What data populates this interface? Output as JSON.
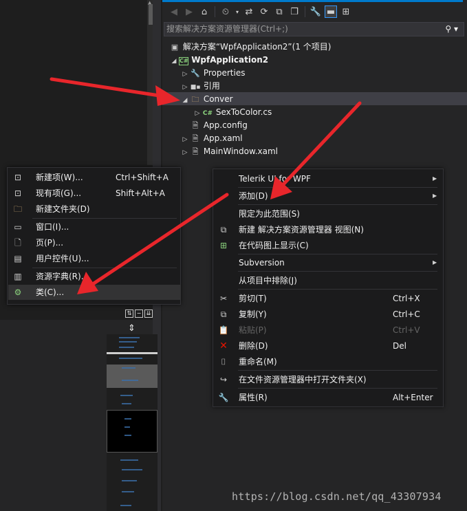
{
  "solution_explorer": {
    "search_placeholder": "搜索解决方案资源管理器(Ctrl+;)",
    "tree": [
      {
        "label": "解决方案“WpfApplication2”(1 个项目)",
        "icon": "solution-icon",
        "level": 0,
        "arrow": ""
      },
      {
        "label": "WpfApplication2",
        "icon": "csharp-project-icon",
        "level": 1,
        "arrow": "expanded",
        "bold": true
      },
      {
        "label": "Properties",
        "icon": "wrench-icon",
        "level": 2,
        "arrow": "collapsed"
      },
      {
        "label": "引用",
        "icon": "references-icon",
        "level": 2,
        "arrow": "collapsed"
      },
      {
        "label": "Conver",
        "icon": "folder-icon",
        "level": 2,
        "arrow": "expanded",
        "selected": true
      },
      {
        "label": "SexToColor.cs",
        "icon": "csharp-file-icon",
        "level": 3,
        "arrow": "collapsed"
      },
      {
        "label": "App.config",
        "icon": "config-icon",
        "level": 2,
        "arrow": ""
      },
      {
        "label": "App.xaml",
        "icon": "xaml-icon",
        "level": 2,
        "arrow": "collapsed"
      },
      {
        "label": "MainWindow.xaml",
        "icon": "xaml-icon",
        "level": 2,
        "arrow": "collapsed"
      }
    ]
  },
  "context_menu": {
    "items": [
      {
        "label": "Telerik UI for WPF",
        "submenu": true
      },
      {
        "label": "添加(D)",
        "submenu": true
      },
      {
        "label": "限定为此范围(S)"
      },
      {
        "label": "新建 解决方案资源管理器 视图(N)",
        "icon": "new-view-icon"
      },
      {
        "label": "在代码图上显示(C)",
        "icon": "code-map-icon"
      },
      {
        "label": "Subversion",
        "submenu": true
      },
      {
        "label": "从项目中排除(J)"
      },
      {
        "label": "剪切(T)",
        "shortcut": "Ctrl+X",
        "icon": "cut-icon"
      },
      {
        "label": "复制(Y)",
        "shortcut": "Ctrl+C",
        "icon": "copy-icon"
      },
      {
        "label": "粘贴(P)",
        "shortcut": "Ctrl+V",
        "icon": "paste-icon",
        "disabled": true
      },
      {
        "label": "删除(D)",
        "shortcut": "Del",
        "icon": "delete-icon"
      },
      {
        "label": "重命名(M)",
        "icon": "rename-icon"
      },
      {
        "label": "在文件资源管理器中打开文件夹(X)",
        "icon": "open-folder-icon"
      },
      {
        "label": "属性(R)",
        "shortcut": "Alt+Enter",
        "icon": "wrench-icon"
      }
    ]
  },
  "add_submenu": {
    "items": [
      {
        "label": "新建项(W)...",
        "shortcut": "Ctrl+Shift+A",
        "icon": "new-item-icon"
      },
      {
        "label": "现有项(G)...",
        "shortcut": "Shift+Alt+A",
        "icon": "existing-item-icon"
      },
      {
        "label": "新建文件夹(D)",
        "icon": "new-folder-icon"
      },
      {
        "label": "窗口(I)...",
        "icon": "window-icon"
      },
      {
        "label": "页(P)...",
        "icon": "page-icon"
      },
      {
        "label": "用户控件(U)...",
        "icon": "user-control-icon"
      },
      {
        "label": "资源字典(R)...",
        "icon": "resource-dictionary-icon"
      },
      {
        "label": "类(C)...",
        "icon": "class-icon",
        "hover": true
      }
    ]
  },
  "colors": {
    "accent": "#007acc",
    "arrow_red": "#e8262b",
    "selection": "#3f3f46",
    "menu_bg": "#1b1b1c"
  },
  "watermark": "https://blog.csdn.net/qq_43307934"
}
